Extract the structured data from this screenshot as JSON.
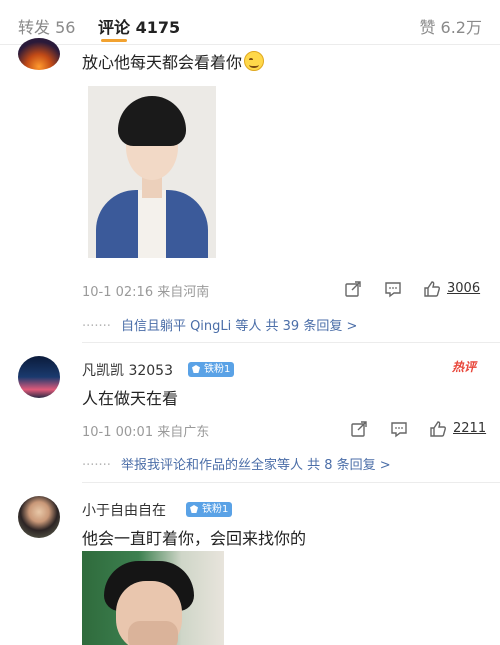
{
  "tabs": {
    "repost": "转发 56",
    "comments": "评论 4175",
    "likes": "赞 6.2万"
  },
  "comments": [
    {
      "text": "放心他每天都会看着你",
      "time": "10-1 02:16",
      "location": "来自河南",
      "like_count": "3006",
      "reply_summary": "自信且躺平 QingLi 等人  共 39 条回复 >"
    },
    {
      "username": "凡凯凯 32053",
      "fan_badge": "铁粉1",
      "hot_tag": "热评",
      "text": "人在做天在看",
      "time": "10-1 00:01",
      "location": "来自广东",
      "like_count": "2211",
      "reply_summary": "举报我评论和作品的丝全家等人  共 8 条回复 >"
    },
    {
      "username": "小于自由自在",
      "fan_badge": "铁粉1",
      "text": "他会一直盯着你，会回来找你的"
    }
  ],
  "icons": {
    "share": "share-icon",
    "comment": "comment-icon",
    "like": "thumbs-up-icon",
    "fan": "diamond-icon"
  },
  "colors": {
    "accent_underline": "#f2a230",
    "link": "#4b6ea8",
    "fan_badge": "#5aa2e6",
    "hot_tag": "#e8463a"
  }
}
